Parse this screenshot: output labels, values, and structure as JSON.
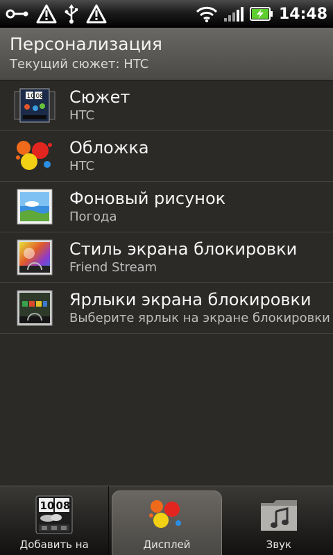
{
  "status_bar": {
    "time": "14:48",
    "icons": [
      "key-link-icon",
      "warning-icon",
      "usb-icon",
      "warning-icon",
      "wifi-icon",
      "signal-icon",
      "battery-charging-icon"
    ]
  },
  "header": {
    "title": "Персонализация",
    "subtitle": "Текущий сюжет: HTC"
  },
  "list": [
    {
      "title": "Сюжет",
      "subtitle": "HTC",
      "icon": "scene-icon"
    },
    {
      "title": "Обложка",
      "subtitle": "HTC",
      "icon": "skin-paint-splash-icon"
    },
    {
      "title": "Фоновый рисунок",
      "subtitle": "Погода",
      "icon": "wallpaper-icon"
    },
    {
      "title": "Стиль экрана блокировки",
      "subtitle": "Friend Stream",
      "icon": "lockscreen-style-icon"
    },
    {
      "title": "Ярлыки экрана блокировки",
      "subtitle": "Выберите ярлык на экране блокировки",
      "icon": "lockscreen-shortcuts-icon"
    }
  ],
  "tabs": [
    {
      "label": "Добавить на",
      "icon": "add-widget-clock-icon",
      "active": false
    },
    {
      "label": "Дисплей",
      "icon": "display-paint-icon",
      "active": true
    },
    {
      "label": "Звук",
      "icon": "sound-folder-icon",
      "active": false
    }
  ],
  "colors": {
    "background": "#2b2a27",
    "header": "#5b5955",
    "battery": "#5fcf2f"
  }
}
